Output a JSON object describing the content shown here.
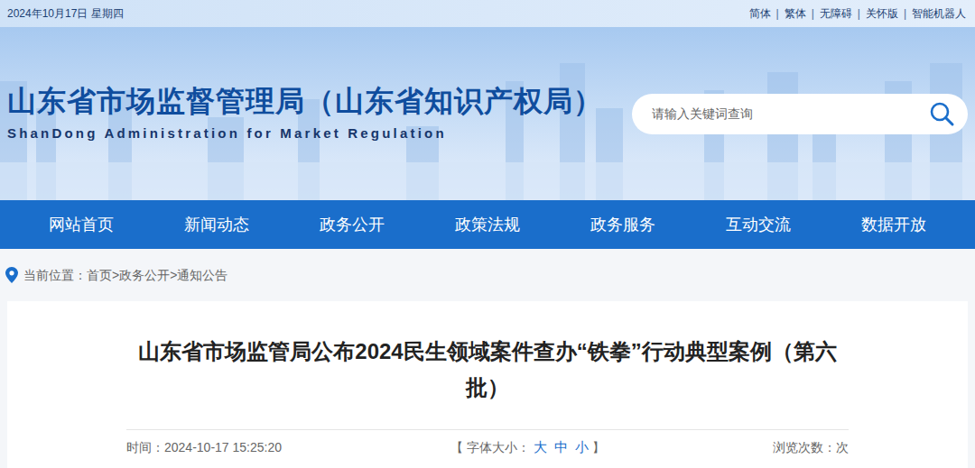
{
  "top_bar": {
    "date": "2024年10月17日 星期四",
    "links": [
      "简体",
      "繁体",
      "无障碍",
      "关怀版",
      "智能机器人"
    ],
    "separator": "|"
  },
  "header": {
    "title": "山东省市场监督管理局（山东省知识产权局）",
    "subtitle": "ShanDong Administration for Market Regulation"
  },
  "search": {
    "placeholder": "请输入关键词查询"
  },
  "nav": [
    "网站首页",
    "新闻动态",
    "政务公开",
    "政策法规",
    "政务服务",
    "互动交流",
    "数据开放"
  ],
  "breadcrumb": {
    "label": "当前位置：",
    "items": [
      "首页",
      "政务公开",
      "通知公告"
    ],
    "separator": ">"
  },
  "article": {
    "title": "山东省市场监管局公布2024民生领域案件查办“铁拳”行动典型案例（第六批）",
    "time": "时间：2024-10-17 15:25:20",
    "font_size": {
      "open": "【",
      "label": "字体大小：",
      "options": [
        "大",
        "中",
        "小"
      ],
      "close": "】"
    },
    "views": "浏览次数：次"
  }
}
